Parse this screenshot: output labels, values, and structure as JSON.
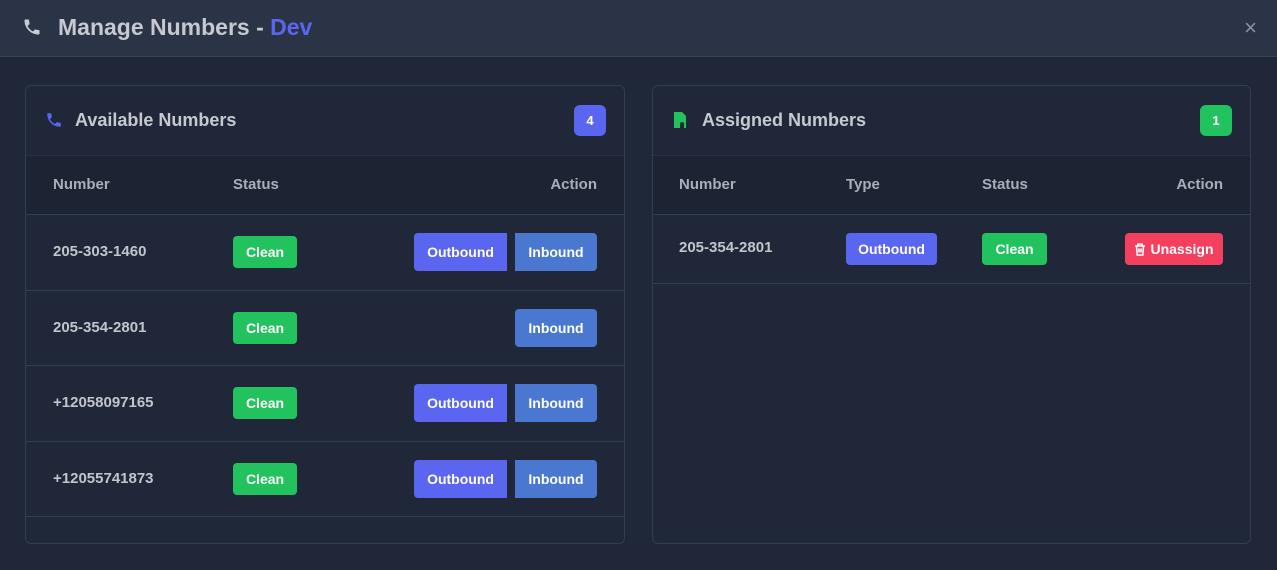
{
  "header": {
    "title": "Manage Numbers - ",
    "env": "Dev",
    "close": "×"
  },
  "available": {
    "title": "Available Numbers",
    "count": "4",
    "columns": [
      "Number",
      "Status",
      "Action"
    ],
    "rows": [
      {
        "number": "205-303-1460",
        "status": "Clean",
        "outbound": "Outbound",
        "inbound": "Inbound"
      },
      {
        "number": "205-354-2801",
        "status": "Clean",
        "inbound": "Inbound"
      },
      {
        "number": "+12058097165",
        "status": "Clean",
        "outbound": "Outbound",
        "inbound": "Inbound"
      },
      {
        "number": "+12055741873",
        "status": "Clean",
        "outbound": "Outbound",
        "inbound": "Inbound"
      }
    ]
  },
  "assigned": {
    "title": "Assigned Numbers",
    "count": "1",
    "columns": [
      "Number",
      "Type",
      "Status",
      "Action"
    ],
    "rows": [
      {
        "number": "205-354-2801",
        "type": "Outbound",
        "status": "Clean",
        "action": "Unassign"
      }
    ]
  },
  "colors": {
    "accent": "#5b66f0",
    "green": "#22c35e",
    "inbound": "#4a78d0",
    "danger": "#f43f5e"
  }
}
